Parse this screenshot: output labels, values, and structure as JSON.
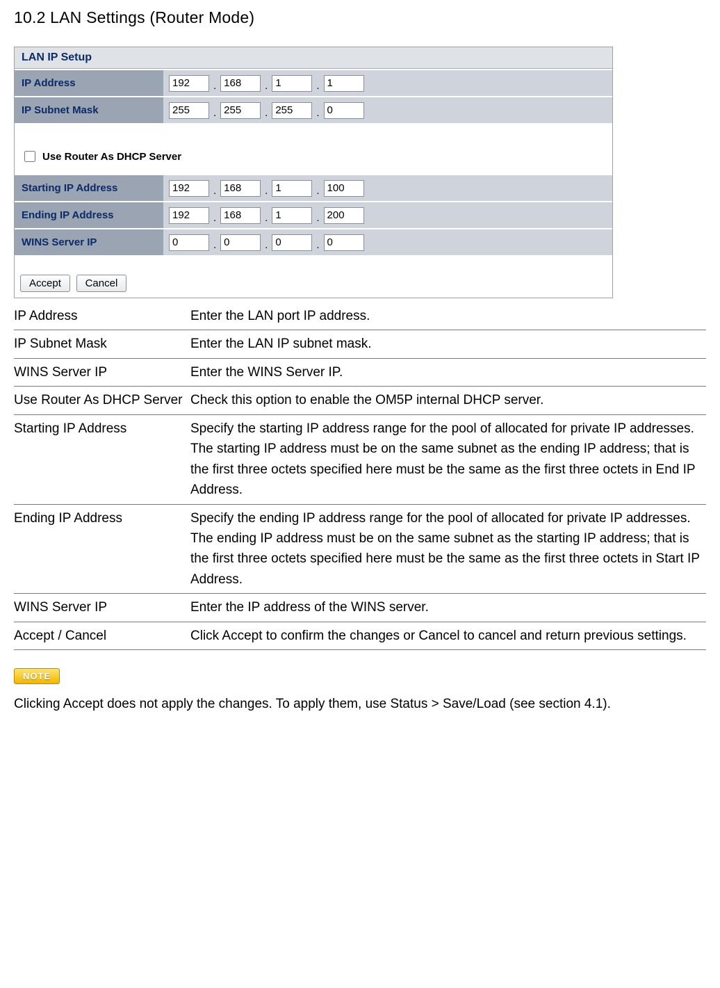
{
  "title": "10.2 LAN Settings (Router Mode)",
  "panel": {
    "section_header": "LAN IP Setup",
    "rows": {
      "ip_address": {
        "label": "IP Address",
        "o1": "192",
        "o2": "168",
        "o3": "1",
        "o4": "1"
      },
      "subnet_mask": {
        "label": "IP Subnet Mask",
        "o1": "255",
        "o2": "255",
        "o3": "255",
        "o4": "0"
      },
      "starting_ip": {
        "label": "Starting IP Address",
        "o1": "192",
        "o2": "168",
        "o3": "1",
        "o4": "100"
      },
      "ending_ip": {
        "label": "Ending IP Address",
        "o1": "192",
        "o2": "168",
        "o3": "1",
        "o4": "200"
      },
      "wins_ip": {
        "label": "WINS Server IP",
        "o1": "0",
        "o2": "0",
        "o3": "0",
        "o4": "0"
      }
    },
    "dhcp_label": "Use Router As DHCP Server",
    "accept_label": "Accept",
    "cancel_label": "Cancel"
  },
  "desc": [
    {
      "term": "IP Address",
      "text": "Enter the LAN port IP address."
    },
    {
      "term": "IP Subnet Mask",
      "text": "Enter the LAN IP subnet mask."
    },
    {
      "term": "WINS Server IP",
      "text": "Enter the WINS Server IP."
    },
    {
      "term": "Use Router As DHCP Server",
      "text": "Check this option to enable the OM5P internal DHCP server."
    },
    {
      "term": "Starting IP Address",
      "text": "Specify the starting IP address range for the pool of allocated for private IP addresses. The starting IP address must be on the same subnet as the ending IP address; that is the first three octets specified here must be the same as the first three octets in End IP Address."
    },
    {
      "term": "Ending IP Address",
      "text": "Specify the ending IP address range for the pool of allocated for private IP addresses. The ending IP address must be on the same subnet as the starting IP address; that is the first three octets specified here must be the same as the first three octets in Start IP Address."
    },
    {
      "term": "WINS Server IP",
      "text": "Enter the IP address of the WINS server."
    },
    {
      "term": "Accept / Cancel",
      "text": "Click Accept to confirm the changes or Cancel to cancel and return previous settings."
    }
  ],
  "note_badge": "NOTE",
  "note_text": "Clicking Accept does not apply the changes. To apply them, use Status > Save/Load (see section 4.1)."
}
